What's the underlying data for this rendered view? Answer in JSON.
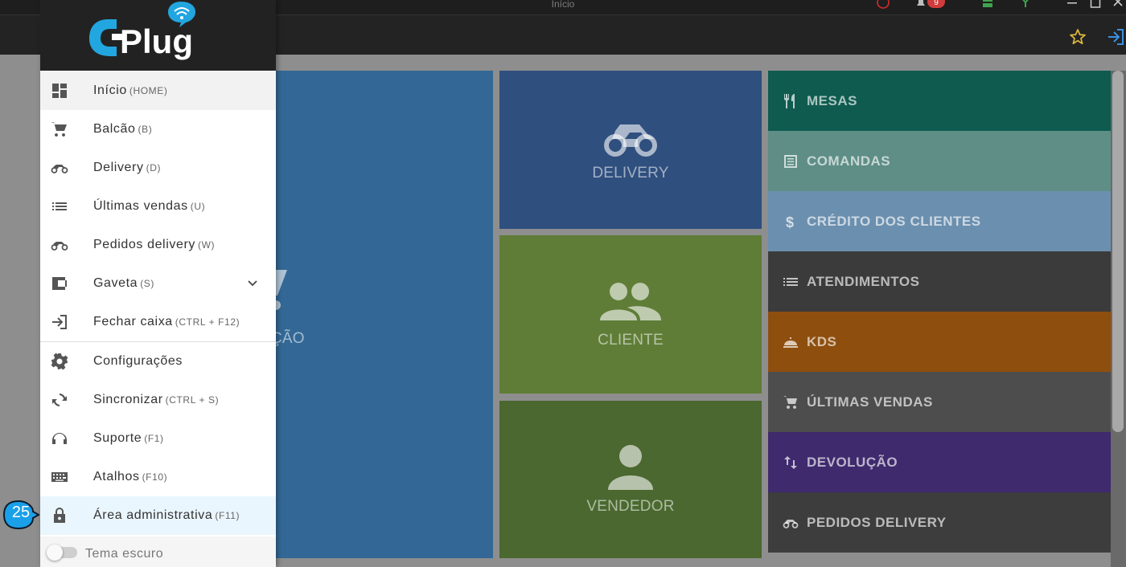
{
  "window": {
    "title": "Início",
    "notification_count": "9"
  },
  "brand": {
    "logo_text": "CPlug"
  },
  "tiles": {
    "balcao_partial": "ÇÃO",
    "delivery": "DELIVERY",
    "cliente": "CLIENTE",
    "vendedor": "VENDEDOR"
  },
  "quick_list": [
    {
      "label": "MESAS",
      "icon": "fork-knife-icon",
      "color": "#0f5b4f"
    },
    {
      "label": "COMANDAS",
      "icon": "list-box-icon",
      "color": "#5e8e86"
    },
    {
      "label": "CRÉDITO DOS CLIENTES",
      "icon": "dollar-icon",
      "color": "#6b8fae"
    },
    {
      "label": "ATENDIMENTOS",
      "icon": "list-icon",
      "color": "#3b3b3b"
    },
    {
      "label": "KDS",
      "icon": "cloche-icon",
      "color": "#8e4e0e"
    },
    {
      "label": "ÚLTIMAS VENDAS",
      "icon": "cart-icon",
      "color": "#4d4d4d"
    },
    {
      "label": "DEVOLUÇÃO",
      "icon": "swap-vertical-icon",
      "color": "#3e2a6d"
    },
    {
      "label": "PEDIDOS DELIVERY",
      "icon": "motorbike-icon",
      "color": "#3d3d3d"
    }
  ],
  "menu": {
    "inicio": {
      "label": "Início",
      "shortcut": "(HOME)"
    },
    "balcao": {
      "label": "Balcão",
      "shortcut": "(B)"
    },
    "delivery": {
      "label": "Delivery",
      "shortcut": "(D)"
    },
    "ultimas_vendas": {
      "label": "Últimas vendas",
      "shortcut": "(U)"
    },
    "pedidos_delivery": {
      "label": "Pedidos delivery",
      "shortcut": "(W)"
    },
    "gaveta": {
      "label": "Gaveta",
      "shortcut": "(S)"
    },
    "fechar_caixa": {
      "label": "Fechar caixa",
      "shortcut": "(CTRL + F12)"
    },
    "configuracoes": {
      "label": "Configurações",
      "shortcut": ""
    },
    "sincronizar": {
      "label": "Sincronizar",
      "shortcut": "(CTRL + S)"
    },
    "suporte": {
      "label": "Suporte",
      "shortcut": "(F1)"
    },
    "atalhos": {
      "label": "Atalhos",
      "shortcut": "(F10)"
    },
    "area_admin": {
      "label": "Área administrativa",
      "shortcut": "(F11)"
    }
  },
  "theme_toggle": {
    "label": "Tema escuro",
    "on": false
  },
  "step_badge": "25",
  "colors": {
    "balcao_tile": "#336896",
    "delivery_tile": "#2f4f7e",
    "cliente_tile": "#5f7d37",
    "vendedor_tile": "#4a682f",
    "badge": "#1aa0e8"
  }
}
